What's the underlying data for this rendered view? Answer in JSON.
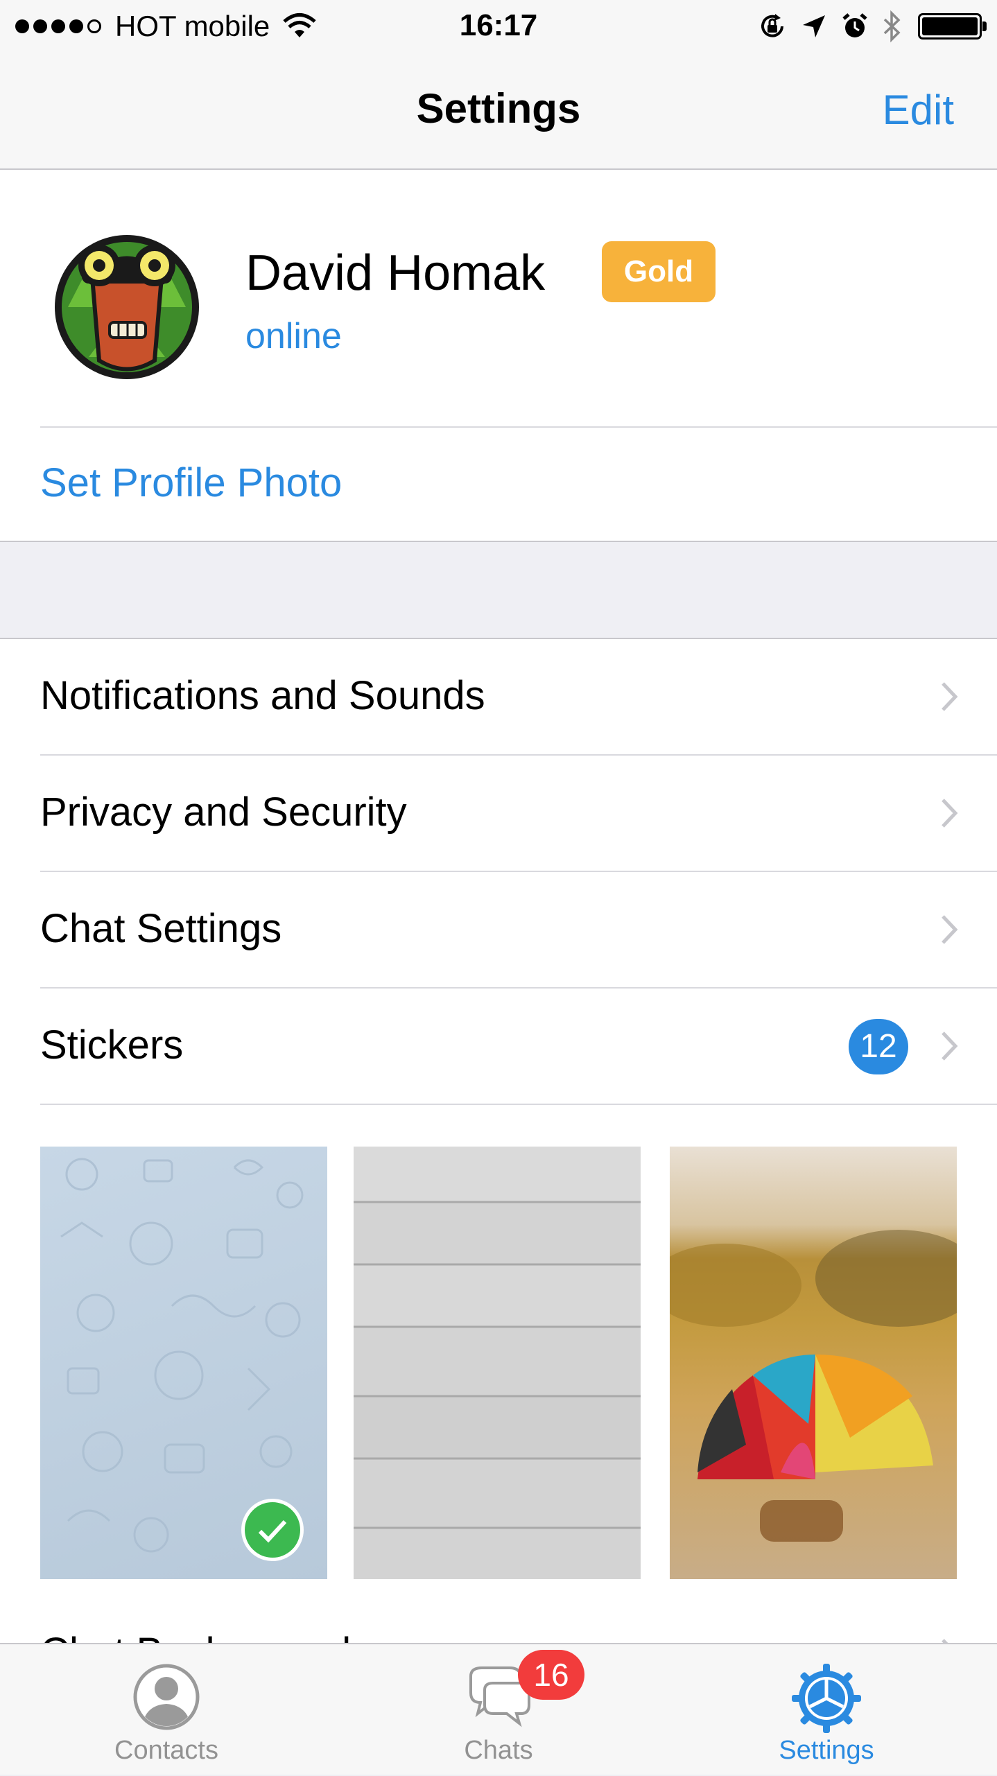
{
  "status_bar": {
    "carrier": "HOT mobile",
    "signal_bars": 4,
    "signal_total": 5,
    "time": "16:17",
    "battery_level": 1.0,
    "icons": [
      "wifi-icon",
      "rotation-lock-icon",
      "location-arrow-icon",
      "alarm-icon",
      "bluetooth-icon",
      "battery-icon"
    ]
  },
  "nav": {
    "title": "Settings",
    "edit_label": "Edit"
  },
  "profile": {
    "name": "David Homak",
    "badge": "Gold",
    "status": "online",
    "set_photo_label": "Set Profile Photo"
  },
  "settings": {
    "items": [
      {
        "label": "Notifications and Sounds"
      },
      {
        "label": "Privacy and Security"
      },
      {
        "label": "Chat Settings"
      },
      {
        "label": "Stickers",
        "badge": "12"
      }
    ],
    "chat_background_label": "Chat Background"
  },
  "tabs": [
    {
      "label": "Contacts",
      "icon": "contacts-icon"
    },
    {
      "label": "Chats",
      "icon": "chats-icon",
      "badge": "16"
    },
    {
      "label": "Settings",
      "icon": "settings-icon",
      "active": true
    }
  ],
  "colors": {
    "accent": "#2a8ae0",
    "gold_badge": "#f7b23b",
    "unread_badge": "#f23c3c",
    "check_green": "#3cb950"
  }
}
